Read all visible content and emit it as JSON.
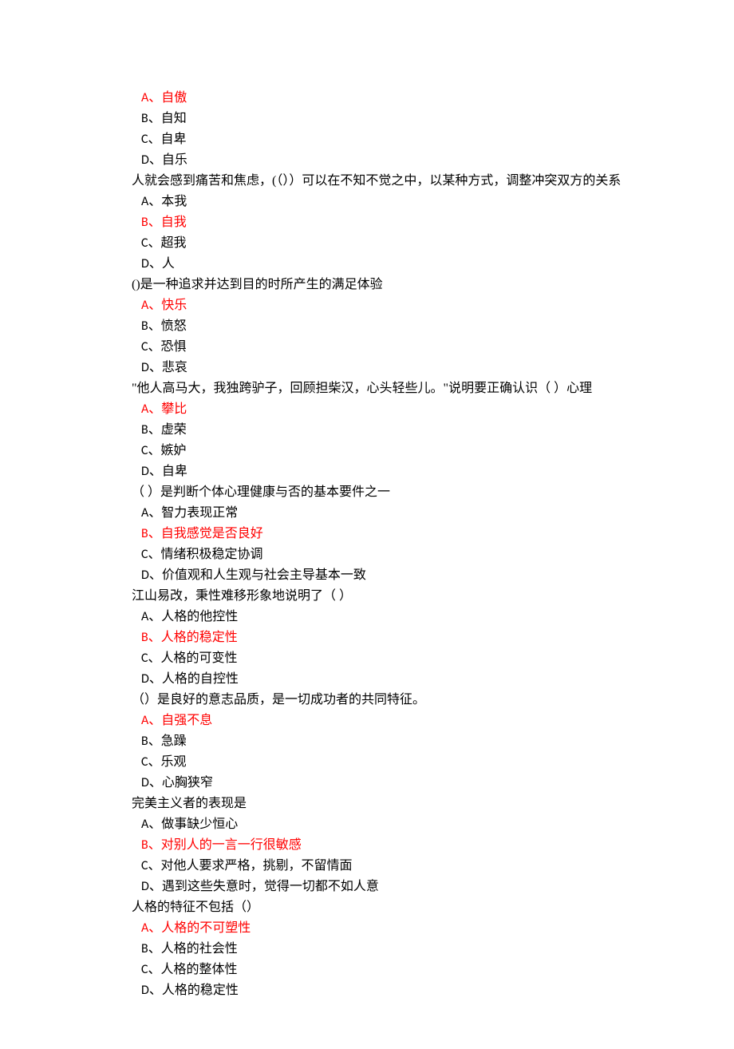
{
  "questions": [
    {
      "stem": "",
      "options": [
        {
          "label": "A、",
          "text": "自傲",
          "correct": true
        },
        {
          "label": "B、",
          "text": "自知",
          "correct": false
        },
        {
          "label": "C、",
          "text": "自卑",
          "correct": false
        },
        {
          "label": "D、",
          "text": "自乐",
          "correct": false
        }
      ]
    },
    {
      "stem": "人就会感到痛苦和焦虑，(（））可以在不知不觉之中，以某种方式，调整冲突双方的关系",
      "options": [
        {
          "label": "A、",
          "text": "本我",
          "correct": false
        },
        {
          "label": "B、",
          "text": "自我",
          "correct": true
        },
        {
          "label": "C、",
          "text": "超我",
          "correct": false
        },
        {
          "label": "D、",
          "text": "人",
          "correct": false
        }
      ]
    },
    {
      "stem": "()是一种追求并达到目的时所产生的满足体验",
      "options": [
        {
          "label": "A、",
          "text": "快乐",
          "correct": true
        },
        {
          "label": "B、",
          "text": "愤怒",
          "correct": false
        },
        {
          "label": "C、",
          "text": "恐惧",
          "correct": false
        },
        {
          "label": "D、",
          "text": "悲哀",
          "correct": false
        }
      ]
    },
    {
      "stem": "\"他人高马大，我独跨驴子，回顾担柴汉，心头轻些儿。\"说明要正确认识（  ）心理",
      "options": [
        {
          "label": "A、",
          "text": "攀比",
          "correct": true
        },
        {
          "label": "B、",
          "text": "虚荣",
          "correct": false
        },
        {
          "label": "C、",
          "text": "嫉妒",
          "correct": false
        },
        {
          "label": "D、",
          "text": "自卑",
          "correct": false
        }
      ]
    },
    {
      "stem": "（  ）是判断个体心理健康与否的基本要件之一",
      "options": [
        {
          "label": "A、",
          "text": "智力表现正常",
          "correct": false
        },
        {
          "label": "B、",
          "text": "自我感觉是否良好",
          "correct": true
        },
        {
          "label": "C、",
          "text": "情绪积极稳定协调",
          "correct": false
        },
        {
          "label": "D、",
          "text": "价值观和人生观与社会主导基本一致",
          "correct": false
        }
      ]
    },
    {
      "stem": "江山易改，秉性难移形象地说明了（  ）",
      "options": [
        {
          "label": "A、",
          "text": "人格的他控性",
          "correct": false
        },
        {
          "label": "B、",
          "text": "人格的稳定性",
          "correct": true
        },
        {
          "label": "C、",
          "text": "人格的可变性",
          "correct": false
        },
        {
          "label": "D、",
          "text": "人格的自控性",
          "correct": false
        }
      ]
    },
    {
      "stem": "（）是良好的意志品质，是一切成功者的共同特征。",
      "options": [
        {
          "label": "A、",
          "text": "自强不息",
          "correct": true
        },
        {
          "label": "B、",
          "text": "急躁",
          "correct": false
        },
        {
          "label": "C、",
          "text": "乐观",
          "correct": false
        },
        {
          "label": "D、",
          "text": "心胸狭窄",
          "correct": false
        }
      ]
    },
    {
      "stem": "完美主义者的表现是",
      "options": [
        {
          "label": "A、",
          "text": "做事缺少恒心",
          "correct": false
        },
        {
          "label": "B、",
          "text": "对别人的一言一行很敏感",
          "correct": true
        },
        {
          "label": "C、",
          "text": "对他人要求严格，挑剔，不留情面",
          "correct": false
        },
        {
          "label": "D、",
          "text": "遇到这些失意时，觉得一切都不如人意",
          "correct": false
        }
      ]
    },
    {
      "stem": "人格的特征不包括（）",
      "options": [
        {
          "label": "A、",
          "text": "人格的不可塑性",
          "correct": true
        },
        {
          "label": "B、",
          "text": "人格的社会性",
          "correct": false
        },
        {
          "label": "C、",
          "text": "人格的整体性",
          "correct": false
        },
        {
          "label": "D、",
          "text": "人格的稳定性",
          "correct": false
        }
      ]
    }
  ]
}
